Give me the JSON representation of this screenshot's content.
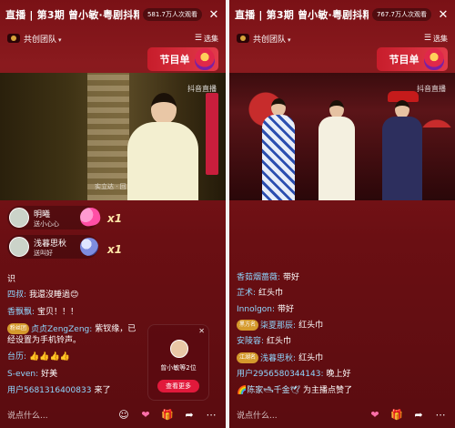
{
  "left": {
    "title": "直播 | 第3期  曾小敏·粤剧抖精..",
    "viewers": "581.7万人次观看",
    "team": "共创团队",
    "collection_label": "选集",
    "program_label": "节目单",
    "watermark": "抖音直播",
    "caption": "实立达 · 回",
    "gifts": [
      {
        "name": "明曦",
        "action": "送小心心",
        "count": "x1"
      },
      {
        "name": "浅暮思秋",
        "action": "送叫好",
        "count": "x1"
      }
    ],
    "messages": [
      {
        "user": "",
        "text": "识"
      },
      {
        "user": "四叔:",
        "text": "我還沒睡過😊"
      },
      {
        "user": "香飘飘:",
        "text": "宝贝！！！"
      },
      {
        "user": "贞贞ZengZeng:",
        "badge": "粉丝团",
        "text": "紫钗缘，已经设置为手机铃声。"
      },
      {
        "user": "台历:",
        "text": "👍👍👍👍"
      },
      {
        "user": "S-even:",
        "text": "好美"
      },
      {
        "user": "用户5681316400833",
        "text": "来了"
      }
    ],
    "promo": {
      "label": "曾小敏等2位",
      "button": "查看更多"
    },
    "say_placeholder": "说点什么..."
  },
  "right": {
    "title": "直播 | 第3期  曾小敏·粤剧抖精..",
    "viewers": "767.7万人次观看",
    "team": "共创团队",
    "collection_label": "选集",
    "program_label": "节目单",
    "watermark": "抖音直播",
    "messages": [
      {
        "user": "香茹烟蔷薇:",
        "text": "带好"
      },
      {
        "user": "芷术:",
        "text": "红头巾"
      },
      {
        "user": "Innolgon:",
        "text": "带好"
      },
      {
        "user": "柒夏那辰:",
        "badge": "黑方名",
        "text": "红头巾"
      },
      {
        "user": "安陵容:",
        "text": "红头巾"
      },
      {
        "user": "浅暮思秋:",
        "badge": "江湖名",
        "text": "红头巾"
      },
      {
        "user": "用户2956580344143:",
        "text": "晚上好"
      },
      {
        "user": "🌈陈家🛥千金🕊",
        "text": "为主播点赞了"
      }
    ],
    "say_placeholder": "说点什么..."
  }
}
